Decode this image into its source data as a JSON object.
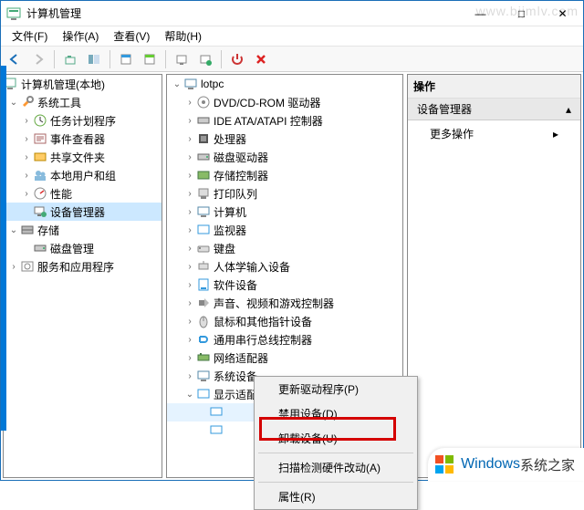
{
  "window": {
    "title": "计算机管理",
    "min": "—",
    "max": "□",
    "close": "✕"
  },
  "menu": {
    "file": "文件(F)",
    "action": "操作(A)",
    "view": "查看(V)",
    "help": "帮助(H)"
  },
  "left_tree": {
    "root": "计算机管理(本地)",
    "sys_tools": "系统工具",
    "task_scheduler": "任务计划程序",
    "event_viewer": "事件查看器",
    "shared_folders": "共享文件夹",
    "local_users": "本地用户和组",
    "performance": "性能",
    "device_manager": "设备管理器",
    "storage": "存储",
    "disk_mgmt": "磁盘管理",
    "services_apps": "服务和应用程序"
  },
  "mid_tree": {
    "root": "lotpc",
    "items": [
      "DVD/CD-ROM 驱动器",
      "IDE ATA/ATAPI 控制器",
      "处理器",
      "磁盘驱动器",
      "存储控制器",
      "打印队列",
      "计算机",
      "监视器",
      "键盘",
      "人体学输入设备",
      "软件设备",
      "声音、视频和游戏控制器",
      "鼠标和其他指针设备",
      "通用串行总线控制器",
      "网络适配器",
      "系统设备",
      "显示适配器"
    ]
  },
  "right": {
    "header": "操作",
    "subheader": "设备管理器",
    "more": "更多操作"
  },
  "context_menu": {
    "update": "更新驱动程序(P)",
    "disable": "禁用设备(D)",
    "uninstall": "卸载设备(U)",
    "scan": "扫描检测硬件改动(A)",
    "properties": "属性(R)"
  },
  "watermark": "www.bjjmlv.com",
  "footer": {
    "brand": "Windows",
    "suffix": "系统之家"
  }
}
